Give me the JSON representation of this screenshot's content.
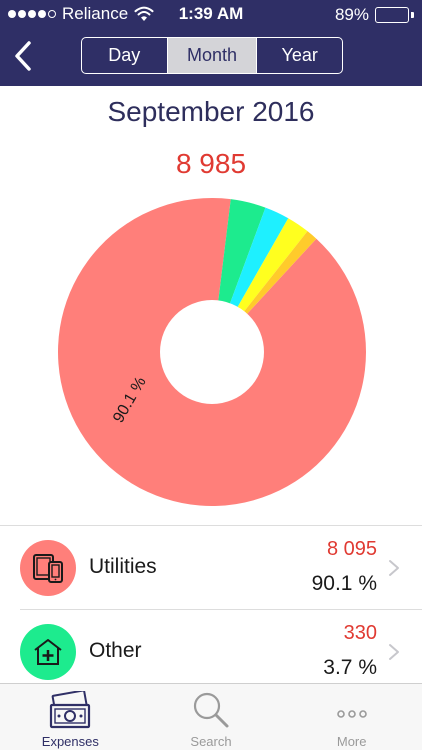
{
  "status_bar": {
    "carrier": "Reliance",
    "time": "1:39 AM",
    "battery": "89%"
  },
  "header": {
    "segments": [
      {
        "label": "Day",
        "active": false
      },
      {
        "label": "Month",
        "active": true
      },
      {
        "label": "Year",
        "active": false
      }
    ]
  },
  "summary": {
    "period": "September 2016",
    "total": "8 985"
  },
  "chart_data": {
    "type": "pie",
    "categories": [
      "Utilities",
      "Other",
      "",
      "",
      ""
    ],
    "values": [
      90.1,
      3.7,
      2.6,
      2.4,
      1.2
    ],
    "slice_labels": [
      "90.1 %",
      "",
      "",
      "",
      ""
    ],
    "colors": [
      "#ff7f7a",
      "#1deb8e",
      "#1ef0ff",
      "#ffff1f",
      "#ffcb2b"
    ],
    "donut": true
  },
  "categories": [
    {
      "name": "Utilities",
      "amount": "8 095",
      "percent": "90.1 %",
      "icon": "devices-icon",
      "color": "#ff7f7a"
    },
    {
      "name": "Other",
      "amount": "330",
      "percent": "3.7 %",
      "icon": "house-plus-icon",
      "color": "#1deb8e"
    }
  ],
  "tabbar": {
    "tabs": [
      {
        "label": "Expenses",
        "icon": "money-icon",
        "active": true
      },
      {
        "label": "Search",
        "icon": "search-icon",
        "active": false
      },
      {
        "label": "More",
        "icon": "more-icon",
        "active": false
      }
    ]
  },
  "colors": {
    "header_bg": "#2f2f66",
    "accent_red": "#e03a32"
  }
}
